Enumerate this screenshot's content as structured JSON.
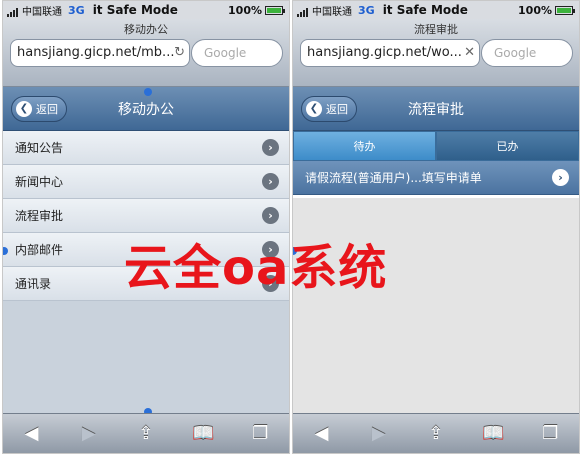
{
  "overlay_text": "云全oa系统",
  "left": {
    "status": {
      "carrier": "中国联通",
      "network": "3G",
      "mode": "it Safe Mode",
      "battery": "100%"
    },
    "page_title": "移动办公",
    "url": "hansjiang.gicp.net/mb...",
    "search_placeholder": "Google",
    "back_label": "返回",
    "header_title": "移动办公",
    "menu": [
      {
        "label": "通知公告"
      },
      {
        "label": "新闻中心"
      },
      {
        "label": "流程审批"
      },
      {
        "label": "内部邮件"
      },
      {
        "label": "通讯录"
      }
    ]
  },
  "right": {
    "status": {
      "carrier": "中国联通",
      "network": "3G",
      "mode": "it Safe Mode",
      "battery": "100%"
    },
    "page_title": "流程审批",
    "url": "hansjiang.gicp.net/wo...",
    "search_placeholder": "Google",
    "back_label": "返回",
    "header_title": "流程审批",
    "tabs": [
      {
        "label": "待办"
      },
      {
        "label": "已办"
      }
    ],
    "flow_item": "请假流程(普通用户)...填写申请单"
  },
  "icons": {
    "reload": "reload-icon",
    "back": "back-arrow-icon",
    "forward": "forward-arrow-icon",
    "share": "share-icon",
    "bookmarks": "bookmarks-icon",
    "pages": "pages-icon",
    "chevron": "chevron-right-icon"
  },
  "colors": {
    "overlay": "#e8151b",
    "header": "#4b73a0",
    "tab_active": "#3d8cc9"
  }
}
